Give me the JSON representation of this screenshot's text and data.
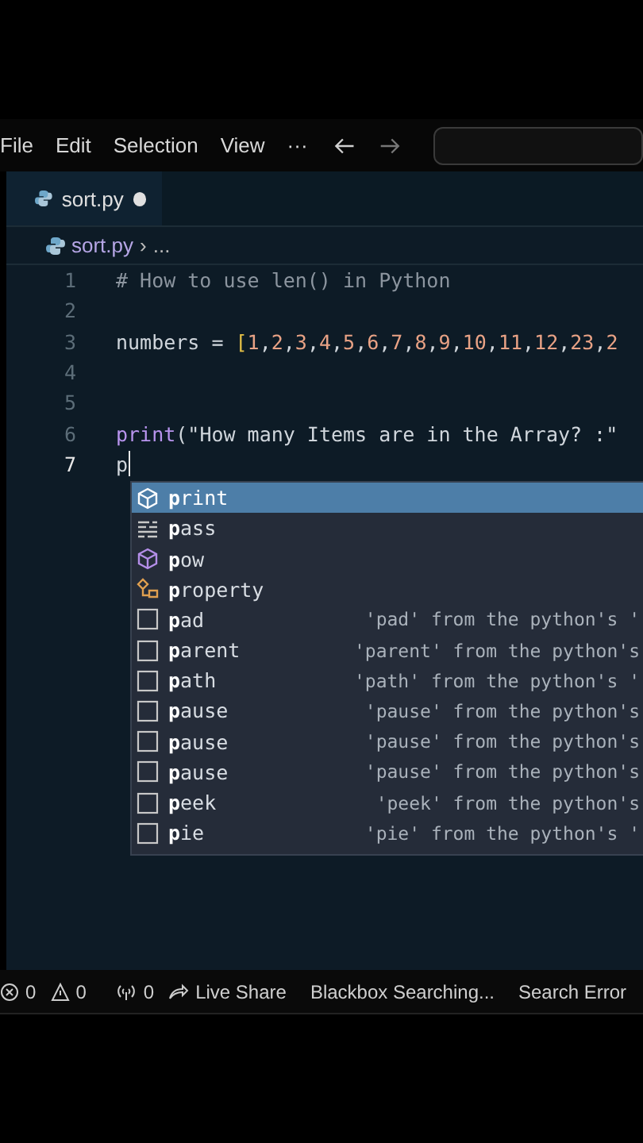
{
  "menu": [
    "File",
    "Edit",
    "Selection",
    "View",
    "···"
  ],
  "tabs": [
    {
      "label": "sort.py",
      "selected": true,
      "modified": true
    }
  ],
  "breadcrumb": {
    "file": "sort.py",
    "separator": "›",
    "rest": "..."
  },
  "lines": [
    {
      "number": "1",
      "current": false,
      "tokens": [
        {
          "kind": "comment",
          "text": "# How to use len() in Python"
        }
      ]
    },
    {
      "number": "2",
      "current": false
    },
    {
      "number": "3",
      "current": false,
      "tokens": [
        {
          "kind": "ident",
          "text": "numbers"
        },
        {
          "kind": "op",
          "text": " = "
        },
        {
          "kind": "bracket",
          "text": "["
        },
        {
          "kind": "number",
          "text": "1"
        },
        {
          "kind": "op",
          "text": ","
        },
        {
          "kind": "number",
          "text": "2"
        },
        {
          "kind": "op",
          "text": ","
        },
        {
          "kind": "number",
          "text": "3"
        },
        {
          "kind": "op",
          "text": ","
        },
        {
          "kind": "number",
          "text": "4"
        },
        {
          "kind": "op",
          "text": ","
        },
        {
          "kind": "number",
          "text": "5"
        },
        {
          "kind": "op",
          "text": ","
        },
        {
          "kind": "number",
          "text": "6"
        },
        {
          "kind": "op",
          "text": ","
        },
        {
          "kind": "number",
          "text": "7"
        },
        {
          "kind": "op",
          "text": ","
        },
        {
          "kind": "number",
          "text": "8"
        },
        {
          "kind": "op",
          "text": ","
        },
        {
          "kind": "number",
          "text": "9"
        },
        {
          "kind": "op",
          "text": ","
        },
        {
          "kind": "number",
          "text": "10"
        },
        {
          "kind": "op",
          "text": ","
        },
        {
          "kind": "number",
          "text": "11"
        },
        {
          "kind": "op",
          "text": ","
        },
        {
          "kind": "number",
          "text": "12"
        },
        {
          "kind": "op",
          "text": ","
        },
        {
          "kind": "number",
          "text": "23"
        },
        {
          "kind": "op",
          "text": ","
        },
        {
          "kind": "number",
          "text": "2"
        }
      ]
    },
    {
      "number": "4",
      "current": false
    },
    {
      "number": "5",
      "current": false
    },
    {
      "number": "6",
      "current": false,
      "tokens": [
        {
          "kind": "func",
          "text": "print"
        },
        {
          "kind": "op",
          "text": "("
        },
        {
          "kind": "string",
          "text": "\"How many Items are in the Array? :\""
        }
      ]
    },
    {
      "number": "7",
      "current": true,
      "tokens": [
        {
          "kind": "ident",
          "text": "p"
        }
      ]
    }
  ],
  "suggestions": [
    {
      "kind": "method",
      "label": "**p**rint",
      "selected": true
    },
    {
      "kind": "keyword",
      "label": "**p**ass",
      "selected": false
    },
    {
      "kind": "method",
      "label": "**p**ow",
      "selected": false
    },
    {
      "kind": "class",
      "label": "**p**roperty",
      "selected": false
    },
    {
      "kind": "text",
      "label": "**p**ad",
      "detail": "'pad' from the python's '",
      "selected": false
    },
    {
      "kind": "text",
      "label": "**p**arent",
      "detail": "'parent' from the python's",
      "selected": false
    },
    {
      "kind": "text",
      "label": "**p**ath",
      "detail": "'path' from the python's '",
      "selected": false
    },
    {
      "kind": "text",
      "label": "**p**ause",
      "detail": "'pause' from the python's",
      "selected": false
    },
    {
      "kind": "text",
      "label": "**p**ause",
      "detail": "'pause' from the python's",
      "selected": false
    },
    {
      "kind": "text",
      "label": "**p**ause",
      "detail": "'pause' from the python's",
      "selected": false
    },
    {
      "kind": "text",
      "label": "**p**eek",
      "detail": "'peek' from the python's",
      "selected": false
    },
    {
      "kind": "text",
      "label": "**p**ie",
      "detail": "'pie' from the python's '",
      "selected": false
    }
  ],
  "status_bar": [
    {
      "kind": "error",
      "text": "0"
    },
    {
      "kind": "warning",
      "text": "0"
    },
    {
      "kind": "ports",
      "text": "0"
    },
    {
      "kind": "liveshare",
      "text": "Live Share"
    },
    {
      "kind": "plain",
      "text": "Blackbox Searching..."
    },
    {
      "kind": "plain",
      "text": "Search Error"
    }
  ]
}
